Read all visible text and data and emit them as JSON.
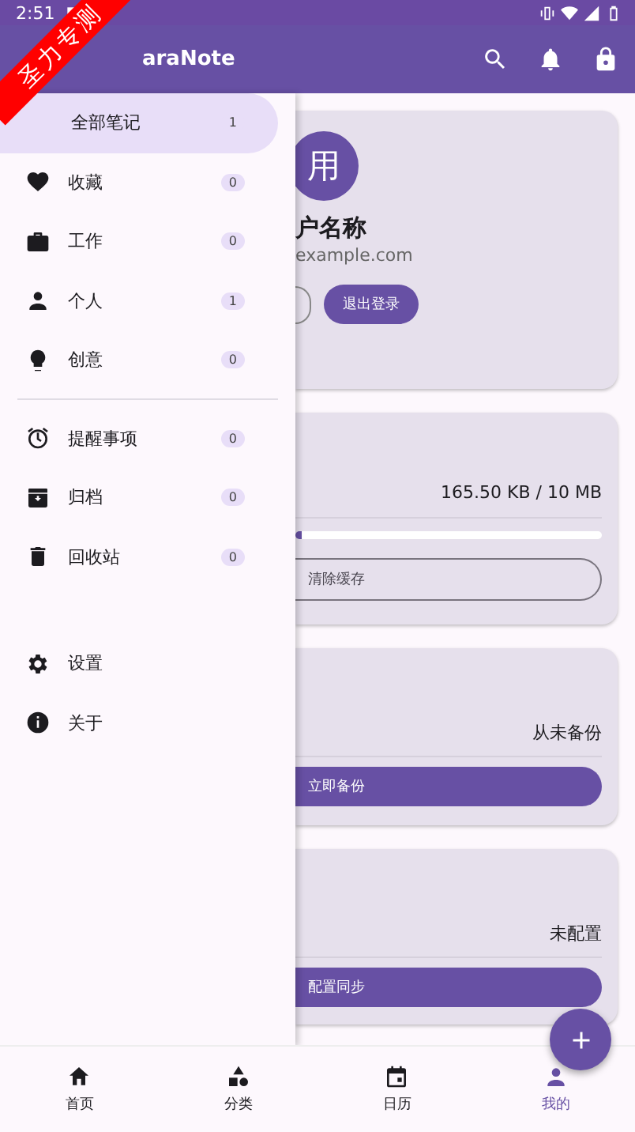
{
  "status_bar": {
    "time": "2:51"
  },
  "app_bar": {
    "title": "araNote"
  },
  "banner": {
    "text": "圣力专测"
  },
  "drawer": {
    "sections": [
      [
        {
          "label": "全部笔记",
          "count": "1",
          "selected": true
        },
        {
          "label": "收藏",
          "count": "0",
          "selected": false
        },
        {
          "label": "工作",
          "count": "0",
          "selected": false
        },
        {
          "label": "个人",
          "count": "1",
          "selected": false
        },
        {
          "label": "创意",
          "count": "0",
          "selected": false
        }
      ],
      [
        {
          "label": "提醒事项",
          "count": "0",
          "selected": false
        },
        {
          "label": "归档",
          "count": "0",
          "selected": false
        },
        {
          "label": "回收站",
          "count": "0",
          "selected": false
        }
      ],
      [
        {
          "label": "设置",
          "selected": false
        },
        {
          "label": "关于",
          "selected": false
        }
      ]
    ]
  },
  "profile": {
    "avatar": "用",
    "name": "户名称",
    "email": "example.com",
    "logout": "退出登录"
  },
  "storage": {
    "usage": "165.50 KB / 10 MB",
    "level": 0.02,
    "button": "清除缓存"
  },
  "backup": {
    "status": "从未备份",
    "button": "立即备份"
  },
  "sync": {
    "status": "未配置",
    "button": "配置同步"
  },
  "bottom_nav": [
    {
      "label": "首页",
      "selected": false
    },
    {
      "label": "分类",
      "selected": false
    },
    {
      "label": "日历",
      "selected": false
    },
    {
      "label": "我的",
      "selected": true
    }
  ]
}
